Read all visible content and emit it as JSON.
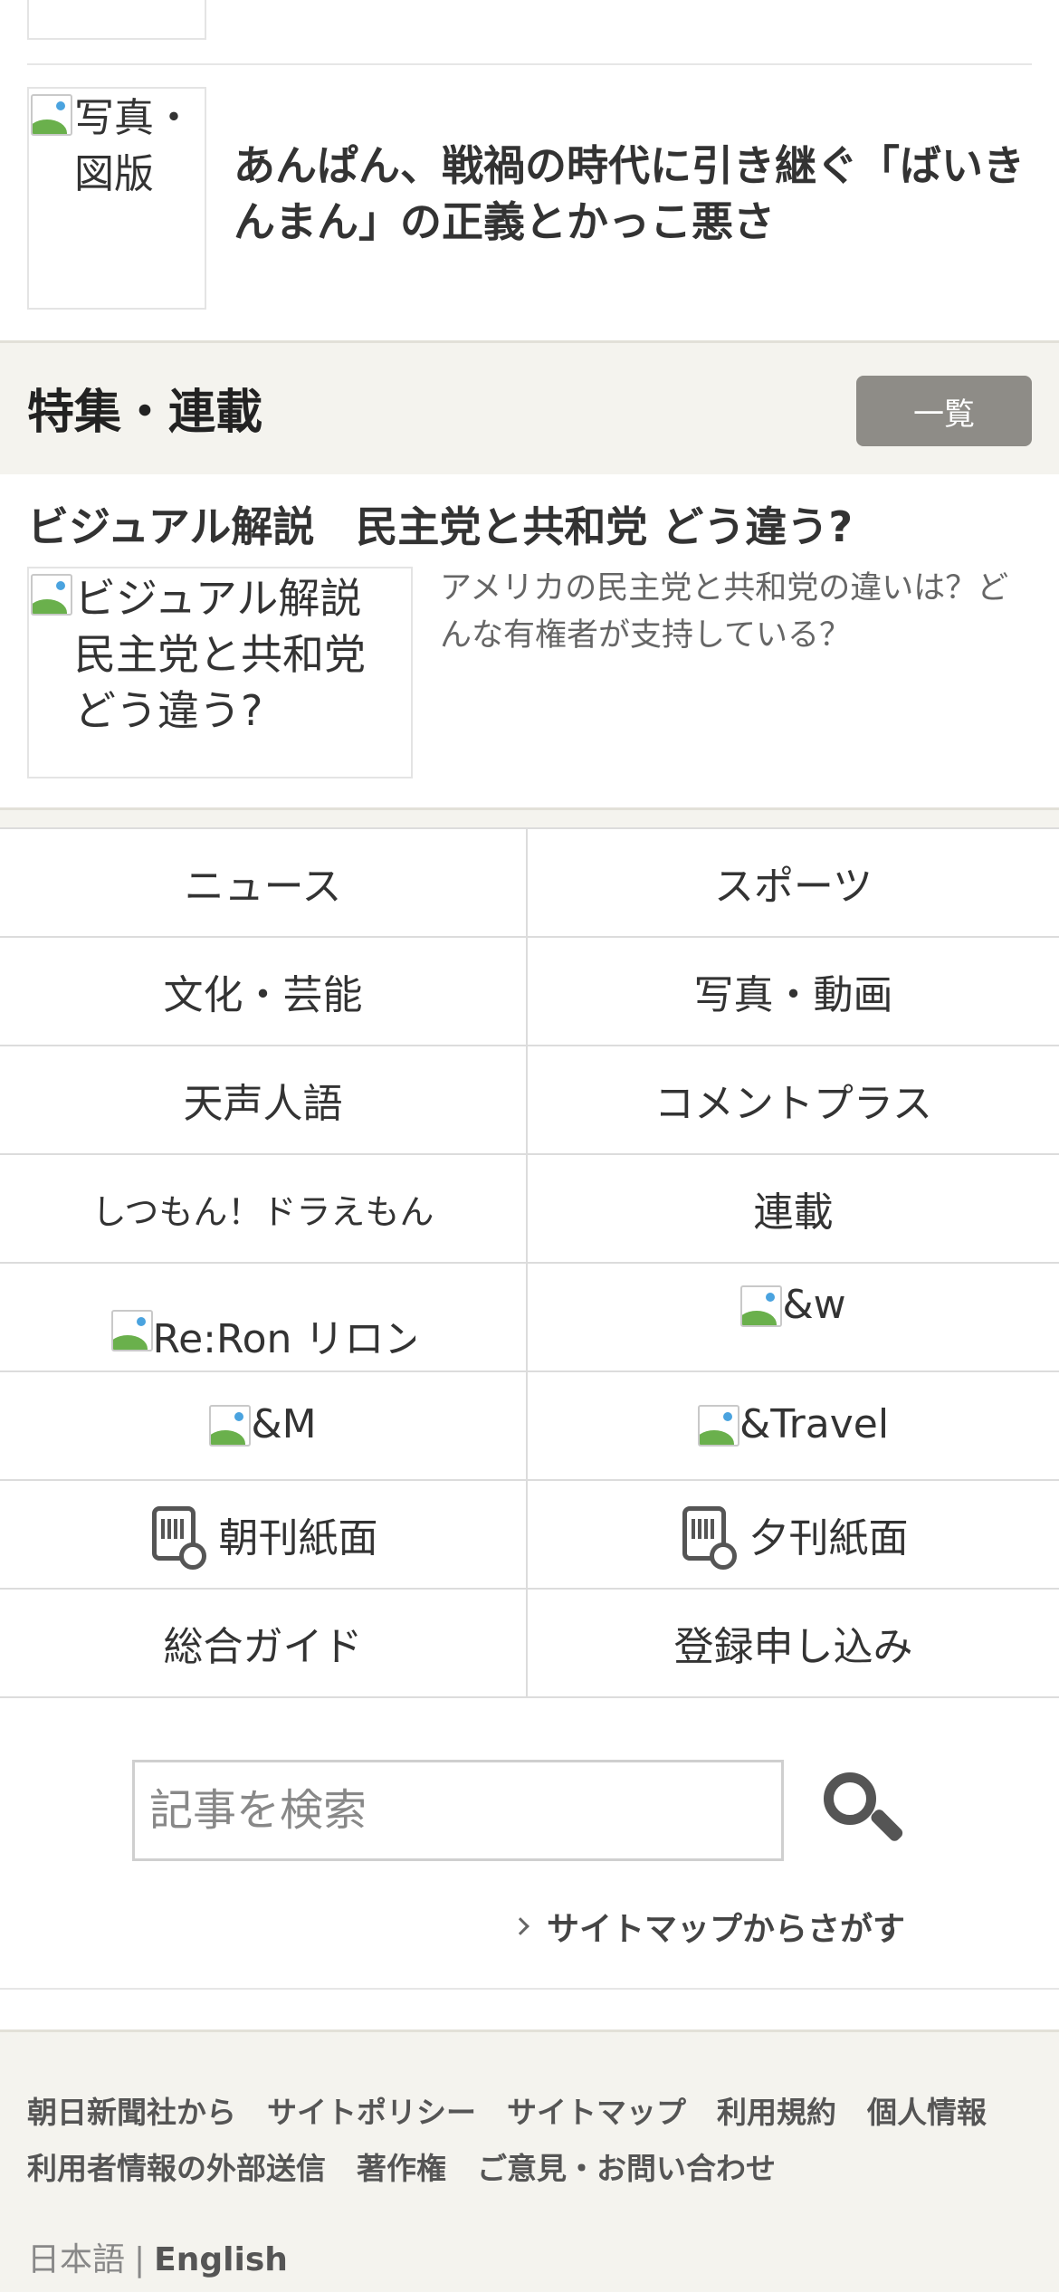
{
  "article": {
    "thumb_alt": "写真・図版",
    "title": "あんぱん、戦禍の時代に引き継ぐ「ばいきんまん」の正義とかっこ悪さ"
  },
  "feature": {
    "heading": "特集・連載",
    "more_label": "一覧",
    "title": "ビジュアル解説　民主党と共和党 どう違う?",
    "thumb_alt": "ビジュアル解説　民主党と共和党 どう違う?",
    "description": "アメリカの民主党と共和党の違いは？どんな有権者が支持している？"
  },
  "nav": {
    "news": "ニュース",
    "sports": "スポーツ",
    "culture": "文化・芸能",
    "photo_video": "写真・動画",
    "tensei": "天声人語",
    "comment_plus": "コメントプラス",
    "doraemon": "しつもん！ドラえもん",
    "serial": "連載",
    "reron": "Re:Ron リロン",
    "and_w": "&w",
    "and_m": "&M",
    "and_travel": "&Travel",
    "morning_paper": "朝刊紙面",
    "evening_paper": "夕刊紙面",
    "guide": "総合ガイド",
    "register": "登録申し込み"
  },
  "search": {
    "placeholder": "記事を検索",
    "sitemap_link": "サイトマップからさがす"
  },
  "footer": {
    "links": [
      "朝日新聞社から",
      "サイトポリシー",
      "サイトマップ",
      "利用規約",
      "個人情報",
      "利用者情報の外部送信",
      "著作権",
      "ご意見・お問い合わせ"
    ],
    "lang_ja": "日本語",
    "lang_sep": "|",
    "lang_en": "English"
  },
  "colors": {
    "band_bg": "#f4f3ee",
    "button_bg": "#8e8c87",
    "text": "#333333"
  }
}
